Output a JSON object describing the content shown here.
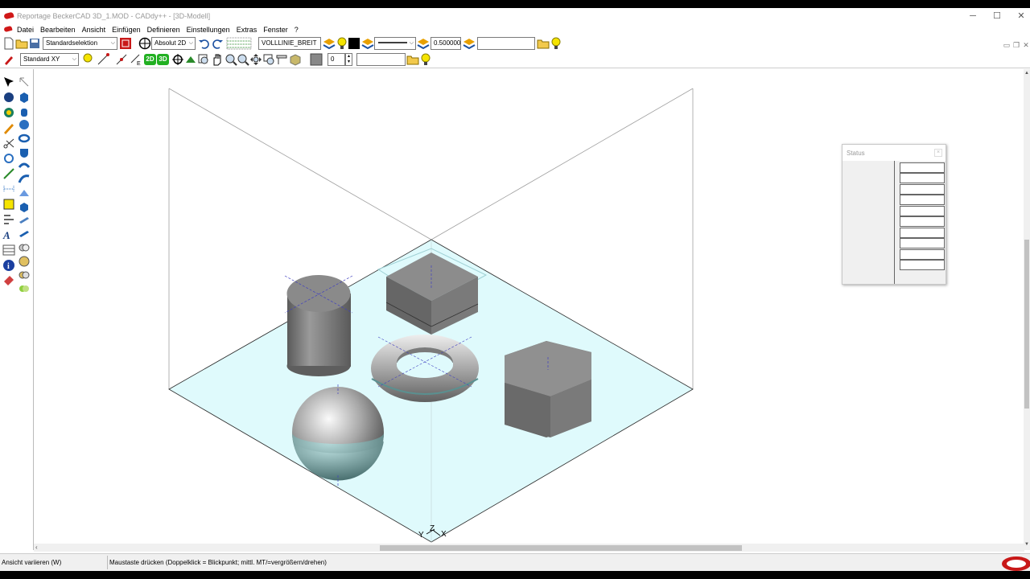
{
  "window": {
    "title": "Reportage BeckerCAD 3D_1.MOD  -  CADdy++ - [3D-Modell]",
    "minimize": "─",
    "maximize": "☐",
    "close": "✕"
  },
  "menu": [
    "Datei",
    "Bearbeiten",
    "Ansicht",
    "Einfügen",
    "Definieren",
    "Einstellungen",
    "Extras",
    "Fenster",
    "?"
  ],
  "toolbar1": {
    "selection_mode": "Standardselektion",
    "coord_mode": "Absolut 2D",
    "line_type": "VOLLLINIE_BREIT",
    "line_width": "0.500000",
    "value_field": ""
  },
  "toolbar2": {
    "view_plane": "Standard XY",
    "btn_2d": "2D",
    "btn_3d": "3D",
    "layer_value": "0",
    "value_field": ""
  },
  "axes": {
    "y": "Y",
    "z": "Z",
    "x": "X"
  },
  "status_panel": {
    "title": "Status",
    "close": "×",
    "rows": 10
  },
  "statusbar": {
    "left": "Ansicht variieren (W)",
    "right": "Maustaste drücken (Doppelklick = Blickpunkt; mittl. MT/=vergrößern/drehen)"
  },
  "colors": {
    "accent_red": "#d01818",
    "floor": "#dffafc",
    "solid": "#8a8a8a"
  }
}
